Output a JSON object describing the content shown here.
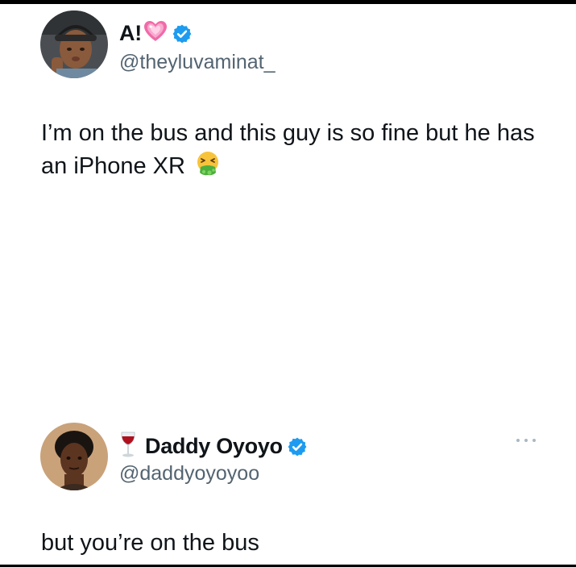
{
  "tweets": [
    {
      "display_name": "A!",
      "name_emoji": "heart-icon",
      "verified": true,
      "handle": "@theyluvaminat_",
      "text": "I’m on the bus and this guy is so fine but he has an iPhone XR",
      "text_emoji": "vomiting-face-icon"
    },
    {
      "display_name": "Daddy Oyoyo",
      "name_prefix_emoji": "wine-glass-icon",
      "verified": true,
      "handle": "@daddyoyoyoo",
      "text": "but you’re on the bus"
    }
  ],
  "colors": {
    "text": "#0f1419",
    "handle": "#536471",
    "verified": "#1d9bf0",
    "heart": "#f06ba8"
  }
}
